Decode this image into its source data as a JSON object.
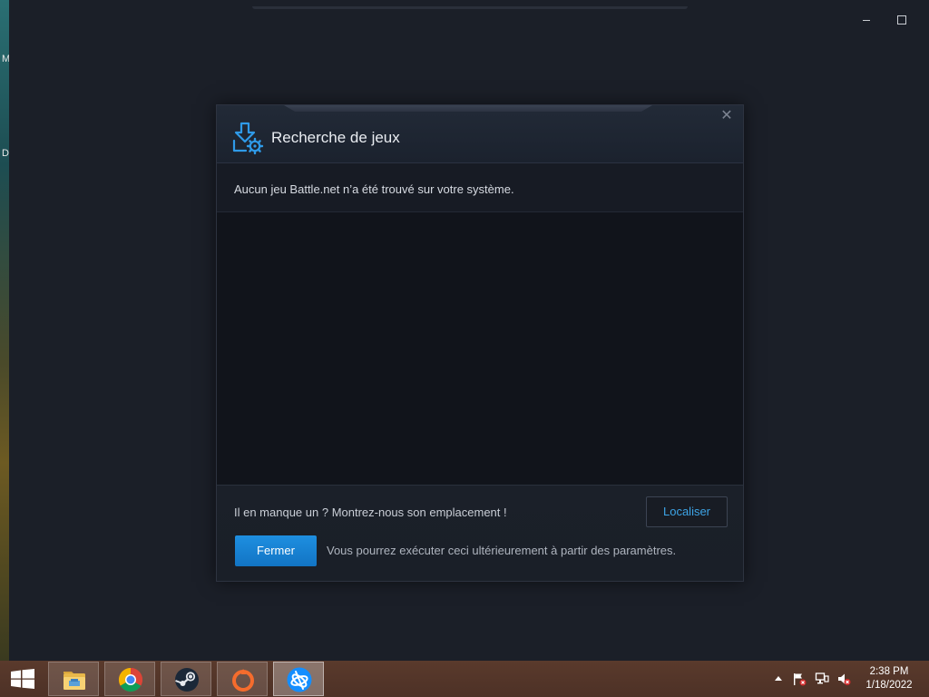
{
  "desktop": {
    "left_fragments": [
      "M",
      "D"
    ]
  },
  "dialog": {
    "title": "Recherche de jeux",
    "close_glyph": "✕",
    "message": "Aucun jeu Battle.net n’a été trouvé sur votre système.",
    "missing_prompt": "Il en manque un ? Montrez-nous son emplacement !",
    "locate_label": "Localiser",
    "close_label": "Fermer",
    "later_note": "Vous pourrez exécuter ceci ultérieurement à partir des paramètres."
  },
  "taskbar": {
    "apps": [
      {
        "name": "File Explorer",
        "icon": "folder-icon"
      },
      {
        "name": "Google Chrome",
        "icon": "chrome-icon"
      },
      {
        "name": "Steam",
        "icon": "steam-icon"
      },
      {
        "name": "Origin",
        "icon": "origin-icon"
      },
      {
        "name": "Battle.net",
        "icon": "battlenet-icon",
        "active": true
      }
    ],
    "tray": {
      "time": "2:38 PM",
      "date": "1/18/2022"
    }
  },
  "colors": {
    "accent_blue": "#1e8fe0",
    "link_blue": "#3da4e6",
    "taskbar": "#5a3a2c",
    "dialog_bg": "#11141b"
  }
}
